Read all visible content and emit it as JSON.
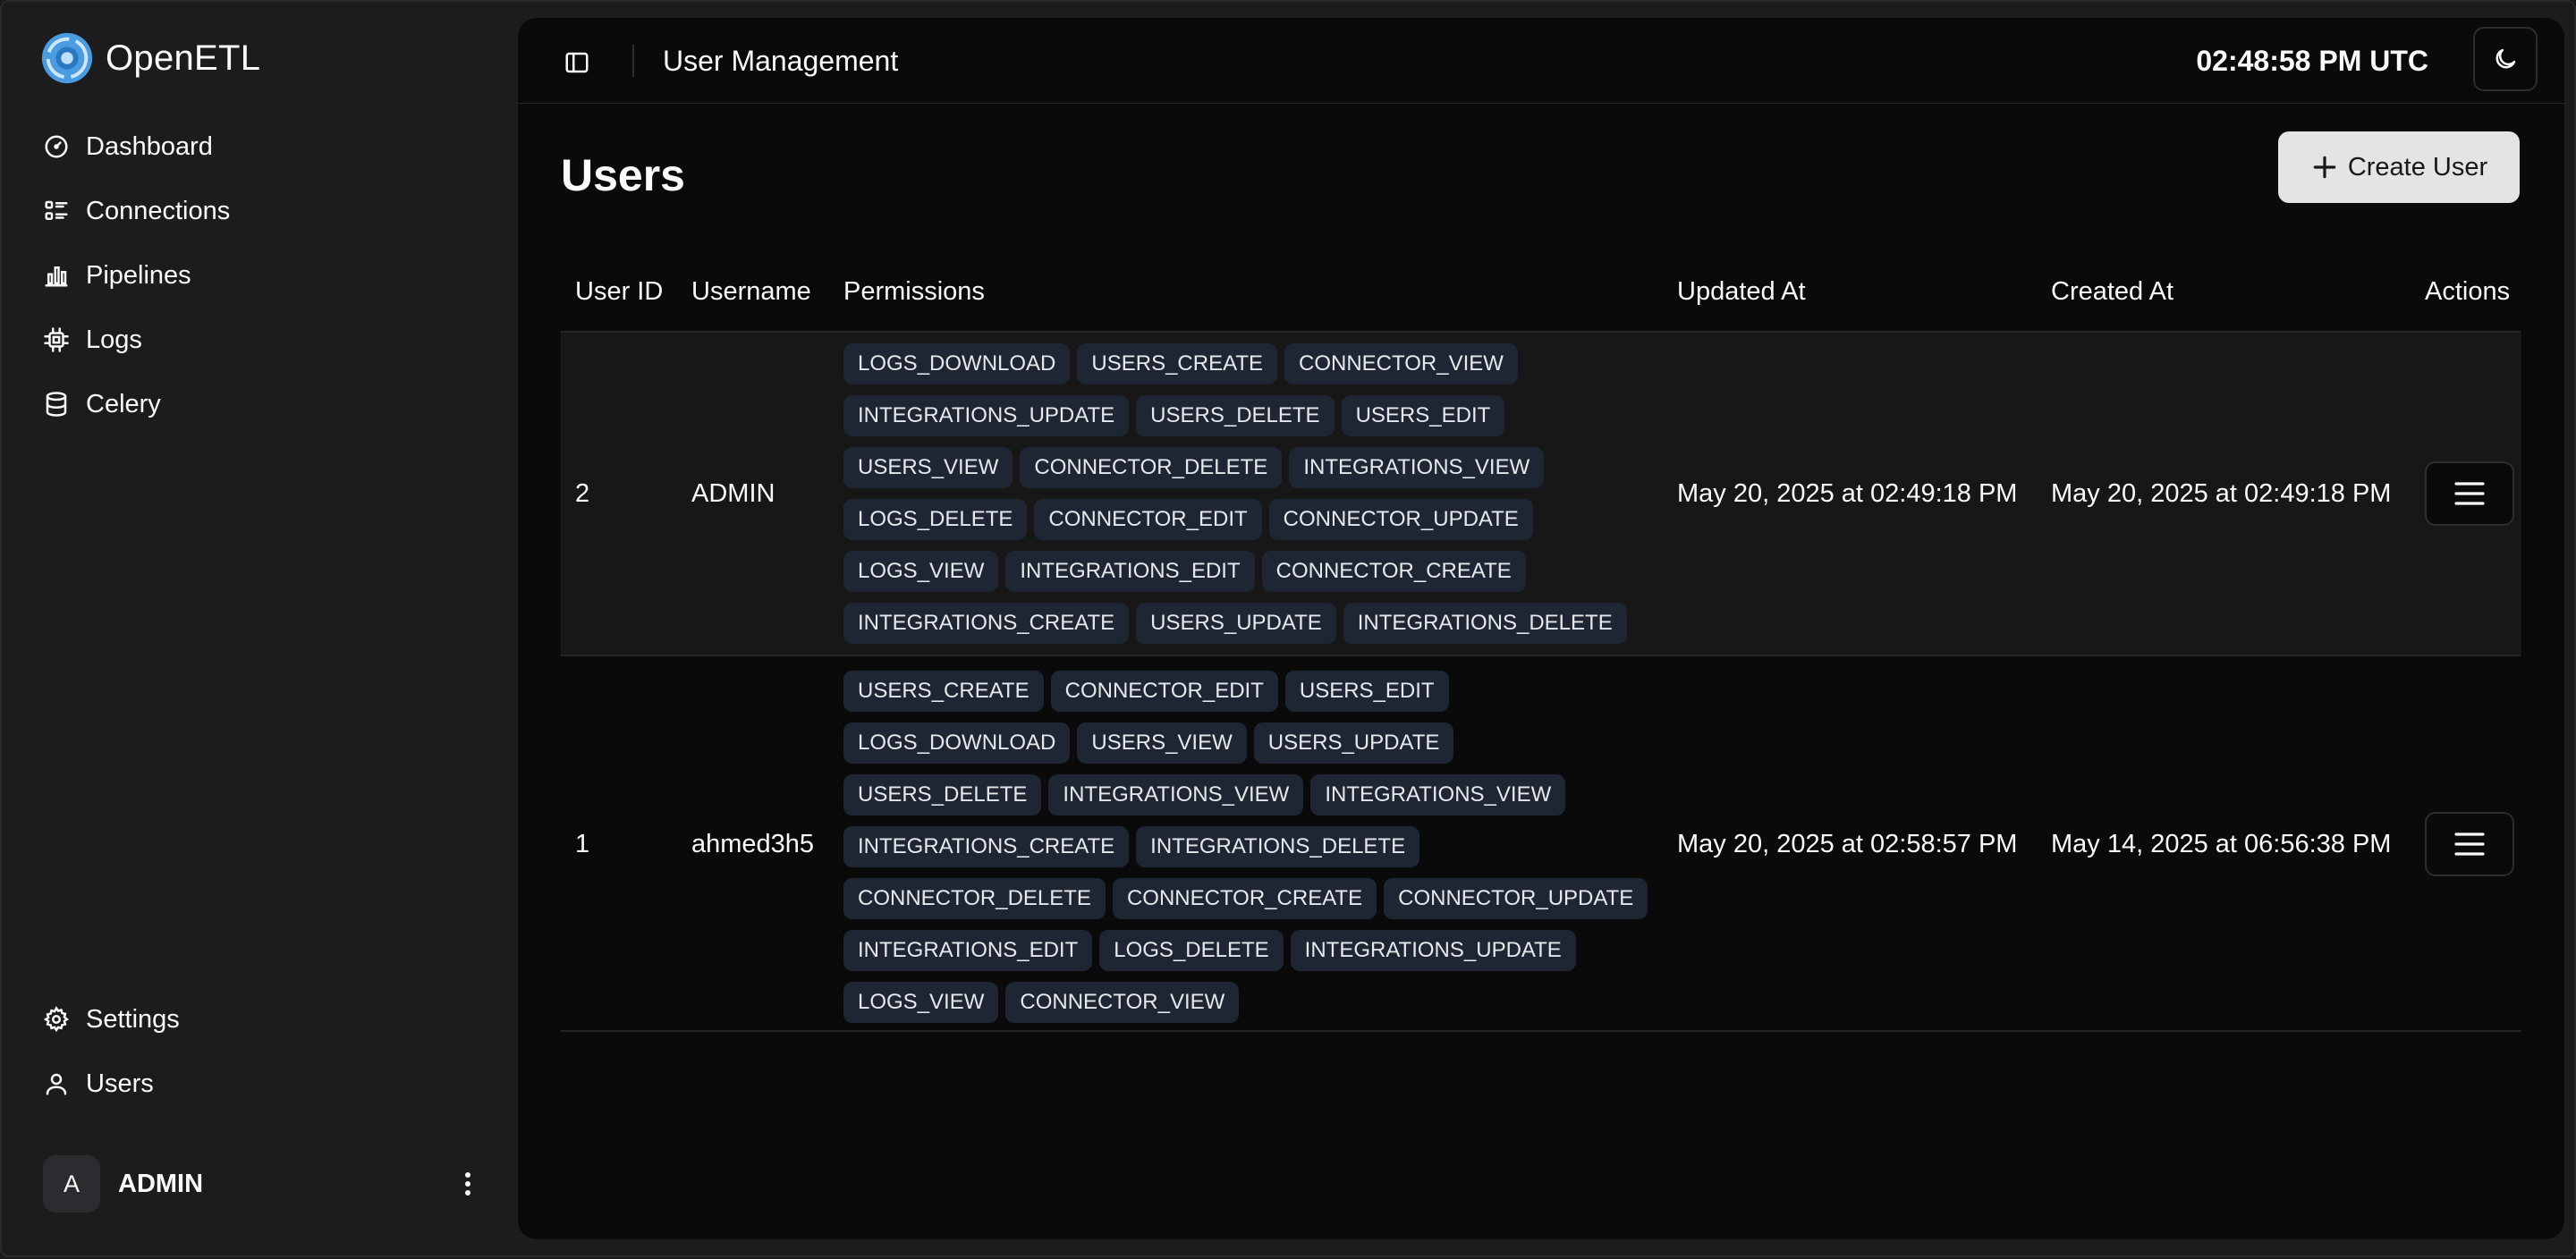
{
  "brand": {
    "name": "OpenETL"
  },
  "sidebar": {
    "items": [
      {
        "label": "Dashboard",
        "icon": "gauge-icon"
      },
      {
        "label": "Connections",
        "icon": "list-icon"
      },
      {
        "label": "Pipelines",
        "icon": "bar-chart-icon"
      },
      {
        "label": "Logs",
        "icon": "cpu-icon"
      },
      {
        "label": "Celery",
        "icon": "database-icon"
      }
    ],
    "bottom_items": [
      {
        "label": "Settings",
        "icon": "gear-icon"
      },
      {
        "label": "Users",
        "icon": "user-icon"
      }
    ],
    "user": {
      "initial": "A",
      "name": "ADMIN"
    }
  },
  "header": {
    "title": "User Management",
    "clock": "02:48:58 PM UTC"
  },
  "page": {
    "title": "Users",
    "create_label": "Create User"
  },
  "table": {
    "columns": [
      "User ID",
      "Username",
      "Permissions",
      "Updated At",
      "Created At",
      "Actions"
    ],
    "rows": [
      {
        "id": "2",
        "username": "ADMIN",
        "permissions": [
          "LOGS_DOWNLOAD",
          "USERS_CREATE",
          "CONNECTOR_VIEW",
          "INTEGRATIONS_UPDATE",
          "USERS_DELETE",
          "USERS_EDIT",
          "USERS_VIEW",
          "CONNECTOR_DELETE",
          "INTEGRATIONS_VIEW",
          "LOGS_DELETE",
          "CONNECTOR_EDIT",
          "CONNECTOR_UPDATE",
          "LOGS_VIEW",
          "INTEGRATIONS_EDIT",
          "CONNECTOR_CREATE",
          "INTEGRATIONS_CREATE",
          "USERS_UPDATE",
          "INTEGRATIONS_DELETE"
        ],
        "updated_at": "May 20, 2025 at 02:49:18 PM",
        "created_at": "May 20, 2025 at 02:49:18 PM"
      },
      {
        "id": "1",
        "username": "ahmed3h5",
        "permissions": [
          "USERS_CREATE",
          "CONNECTOR_EDIT",
          "USERS_EDIT",
          "LOGS_DOWNLOAD",
          "USERS_VIEW",
          "USERS_UPDATE",
          "USERS_DELETE",
          "INTEGRATIONS_VIEW",
          "INTEGRATIONS_VIEW",
          "INTEGRATIONS_CREATE",
          "INTEGRATIONS_DELETE",
          "CONNECTOR_DELETE",
          "CONNECTOR_CREATE",
          "CONNECTOR_UPDATE",
          "INTEGRATIONS_EDIT",
          "LOGS_DELETE",
          "INTEGRATIONS_UPDATE",
          "LOGS_VIEW",
          "CONNECTOR_VIEW"
        ],
        "updated_at": "May 20, 2025 at 02:58:57 PM",
        "created_at": "May 14, 2025 at 06:56:38 PM"
      }
    ]
  },
  "colors": {
    "badge_bg": "#1f2633",
    "accent": "#5aa9e6",
    "button_bg": "#e4e4e7"
  }
}
